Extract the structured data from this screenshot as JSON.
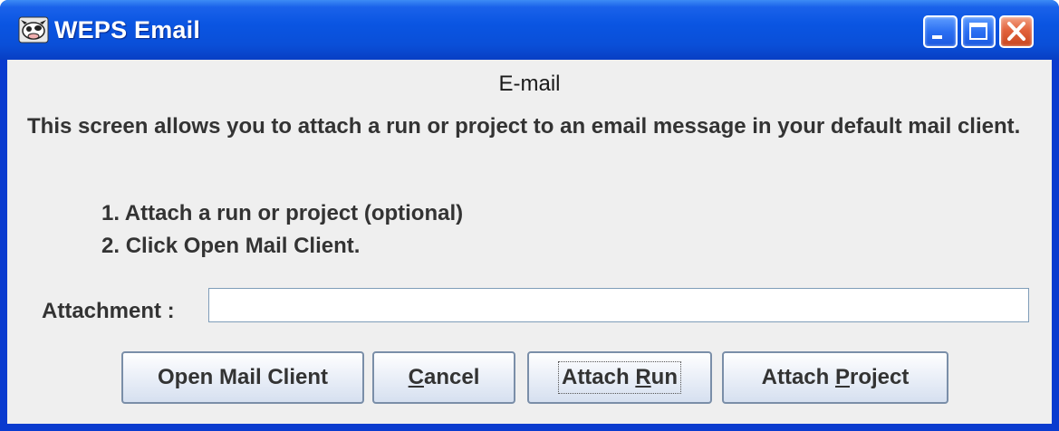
{
  "window": {
    "title": "WEPS Email"
  },
  "content": {
    "heading": "E-mail",
    "description": "This screen allows you to attach a run or project to an email message in your default mail client.",
    "steps": [
      {
        "num": "1.",
        "text": "Attach a run or project (optional)"
      },
      {
        "num": "2.",
        "text": "Click Open Mail Client."
      }
    ],
    "attachment": {
      "label": "Attachment :",
      "value": ""
    }
  },
  "buttons": {
    "open_mail_client": {
      "label": "Open Mail Client"
    },
    "cancel": {
      "mnemonic": "C",
      "rest": "ancel"
    },
    "attach_run": {
      "prefix": "Attach ",
      "mnemonic": "R",
      "rest": "un"
    },
    "attach_project": {
      "prefix": "Attach ",
      "mnemonic": "P",
      "rest": "roject"
    }
  },
  "colors": {
    "titlebar": "#0a55e2",
    "panel": "#efefef",
    "close_button": "#e2623c"
  },
  "icons": {
    "app": "cow-app-icon",
    "minimize": "minimize-icon",
    "maximize": "maximize-icon",
    "close": "close-icon"
  }
}
